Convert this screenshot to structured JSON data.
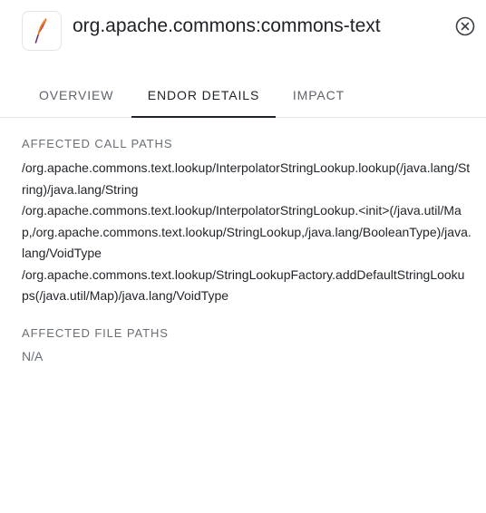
{
  "header": {
    "title": "org.apache.commons:commons-text",
    "logo_icon": "apache-feather-icon",
    "close_icon": "close-circle-icon"
  },
  "tabs": [
    {
      "label": "OVERVIEW",
      "active": false
    },
    {
      "label": "ENDOR DETAILS",
      "active": true
    },
    {
      "label": "IMPACT",
      "active": false
    }
  ],
  "details": {
    "call_paths_label": "AFFECTED CALL PATHS",
    "call_paths": [
      "/org.apache.commons.text.lookup/InterpolatorStringLookup.lookup(/java.lang/String)/java.lang/String",
      "/org.apache.commons.text.lookup/InterpolatorStringLookup.<init>(/java.util/Map,/org.apache.commons.text.lookup/StringLookup,/java.lang/BooleanType)/java.lang/VoidType",
      "/org.apache.commons.text.lookup/StringLookupFactory.addDefaultStringLookups(/java.util/Map)/java.lang/VoidType"
    ],
    "file_paths_label": "AFFECTED FILE PATHS",
    "file_paths_value": "N/A"
  },
  "colors": {
    "text_primary": "#1f2328",
    "text_secondary": "#6a6f76",
    "divider": "#e3e5e8",
    "feather_red": "#c8102e",
    "feather_orange": "#e9731d",
    "feather_purple": "#6d2d7d"
  }
}
